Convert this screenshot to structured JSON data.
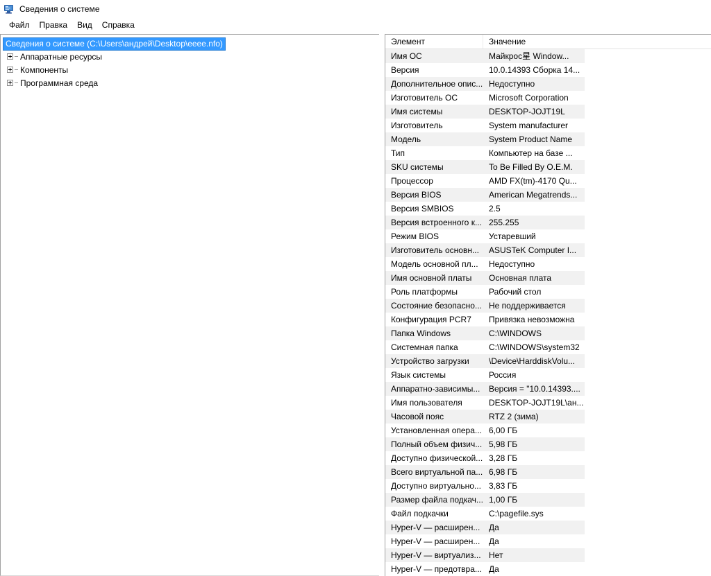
{
  "window": {
    "title": "Сведения о системе",
    "icon": "system-information-icon"
  },
  "menubar": {
    "items": [
      {
        "label": "Файл"
      },
      {
        "label": "Правка"
      },
      {
        "label": "Вид"
      },
      {
        "label": "Справка"
      }
    ]
  },
  "tree": {
    "root": {
      "label": "Сведения о системе (C:\\Users\\андрей\\Desktop\\eeee.nfo)",
      "selected": true,
      "selection_color": "#3399ff"
    },
    "children": [
      {
        "label": "Аппаратные ресурсы",
        "expander": "plus-icon"
      },
      {
        "label": "Компоненты",
        "expander": "plus-icon"
      },
      {
        "label": "Программная среда",
        "expander": "plus-icon"
      }
    ]
  },
  "list": {
    "columns": [
      {
        "key": "item",
        "label": "Элемент"
      },
      {
        "key": "value",
        "label": "Значение"
      }
    ],
    "alt_row_color": "#f1f1f1",
    "rows": [
      {
        "item": "Имя ОС",
        "value": "Майкрос星 Window..."
      },
      {
        "item": "Версия",
        "value": "10.0.14393 Сборка 14..."
      },
      {
        "item": "Дополнительное опис...",
        "value": "Недоступно"
      },
      {
        "item": "Изготовитель ОС",
        "value": "Microsoft Corporation"
      },
      {
        "item": "Имя системы",
        "value": "DESKTOP-JOJT19L"
      },
      {
        "item": "Изготовитель",
        "value": "System manufacturer"
      },
      {
        "item": "Модель",
        "value": "System Product Name"
      },
      {
        "item": "Тип",
        "value": "Компьютер на базе ..."
      },
      {
        "item": "SKU системы",
        "value": "To Be Filled By O.E.M."
      },
      {
        "item": "Процессор",
        "value": "AMD FX(tm)-4170 Qu..."
      },
      {
        "item": "Версия BIOS",
        "value": "American Megatrends..."
      },
      {
        "item": "Версия SMBIOS",
        "value": "2.5"
      },
      {
        "item": "Версия встроенного к...",
        "value": "255.255"
      },
      {
        "item": "Режим BIOS",
        "value": "Устаревший"
      },
      {
        "item": "Изготовитель основн...",
        "value": "ASUSTeK Computer I..."
      },
      {
        "item": "Модель основной пл...",
        "value": "Недоступно"
      },
      {
        "item": "Имя основной платы",
        "value": "Основная плата"
      },
      {
        "item": "Роль платформы",
        "value": "Рабочий стол"
      },
      {
        "item": "Состояние безопасно...",
        "value": "Не поддерживается"
      },
      {
        "item": "Конфигурация PCR7",
        "value": "Привязка невозможна"
      },
      {
        "item": "Папка Windows",
        "value": "C:\\WINDOWS"
      },
      {
        "item": "Системная папка",
        "value": "C:\\WINDOWS\\system32"
      },
      {
        "item": "Устройство загрузки",
        "value": "\\Device\\HarddiskVolu..."
      },
      {
        "item": "Язык системы",
        "value": "Россия"
      },
      {
        "item": "Аппаратно-зависимы...",
        "value": "Версия = \"10.0.14393...."
      },
      {
        "item": "Имя пользователя",
        "value": "DESKTOP-JOJT19L\\ан..."
      },
      {
        "item": "Часовой пояс",
        "value": "RTZ 2 (зима)"
      },
      {
        "item": "Установленная опера...",
        "value": "6,00 ГБ"
      },
      {
        "item": "Полный объем физич...",
        "value": "5,98 ГБ"
      },
      {
        "item": "Доступно физической...",
        "value": "3,28 ГБ"
      },
      {
        "item": "Всего виртуальной па...",
        "value": "6,98 ГБ"
      },
      {
        "item": "Доступно виртуально...",
        "value": "3,83 ГБ"
      },
      {
        "item": "Размер файла подкач...",
        "value": "1,00 ГБ"
      },
      {
        "item": "Файл подкачки",
        "value": "C:\\pagefile.sys"
      },
      {
        "item": "Hyper-V — расширен...",
        "value": "Да"
      },
      {
        "item": "Hyper-V — расширен...",
        "value": "Да"
      },
      {
        "item": "Hyper-V — виртуализ...",
        "value": "Нет"
      },
      {
        "item": "Hyper-V — предотвра...",
        "value": "Да"
      }
    ]
  }
}
